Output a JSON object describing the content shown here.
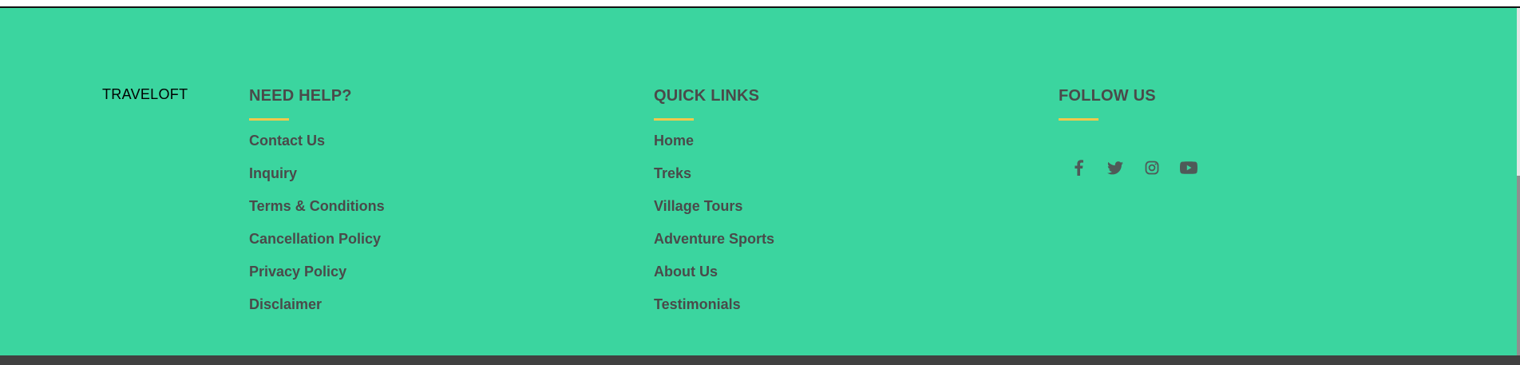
{
  "footer": {
    "brand": "TRAVELOFT",
    "need_help": {
      "title": "NEED HELP?",
      "items": [
        {
          "label": "Contact Us"
        },
        {
          "label": "Inquiry"
        },
        {
          "label": "Terms & Conditions"
        },
        {
          "label": "Cancellation Policy"
        },
        {
          "label": "Privacy Policy"
        },
        {
          "label": "Disclaimer"
        }
      ]
    },
    "quick_links": {
      "title": "QUICK LINKS",
      "items": [
        {
          "label": "Home"
        },
        {
          "label": "Treks"
        },
        {
          "label": "Village Tours"
        },
        {
          "label": "Adventure Sports"
        },
        {
          "label": "About Us"
        },
        {
          "label": "Testimonials"
        }
      ]
    },
    "follow_us": {
      "title": "FOLLOW US",
      "icons": [
        "facebook-icon",
        "twitter-icon",
        "instagram-icon",
        "youtube-icon"
      ]
    }
  },
  "colors": {
    "footer_bg": "#3bd59f",
    "accent_underline": "#f2c94c",
    "text": "#4a4a4a",
    "bottom_bar": "#404040"
  }
}
